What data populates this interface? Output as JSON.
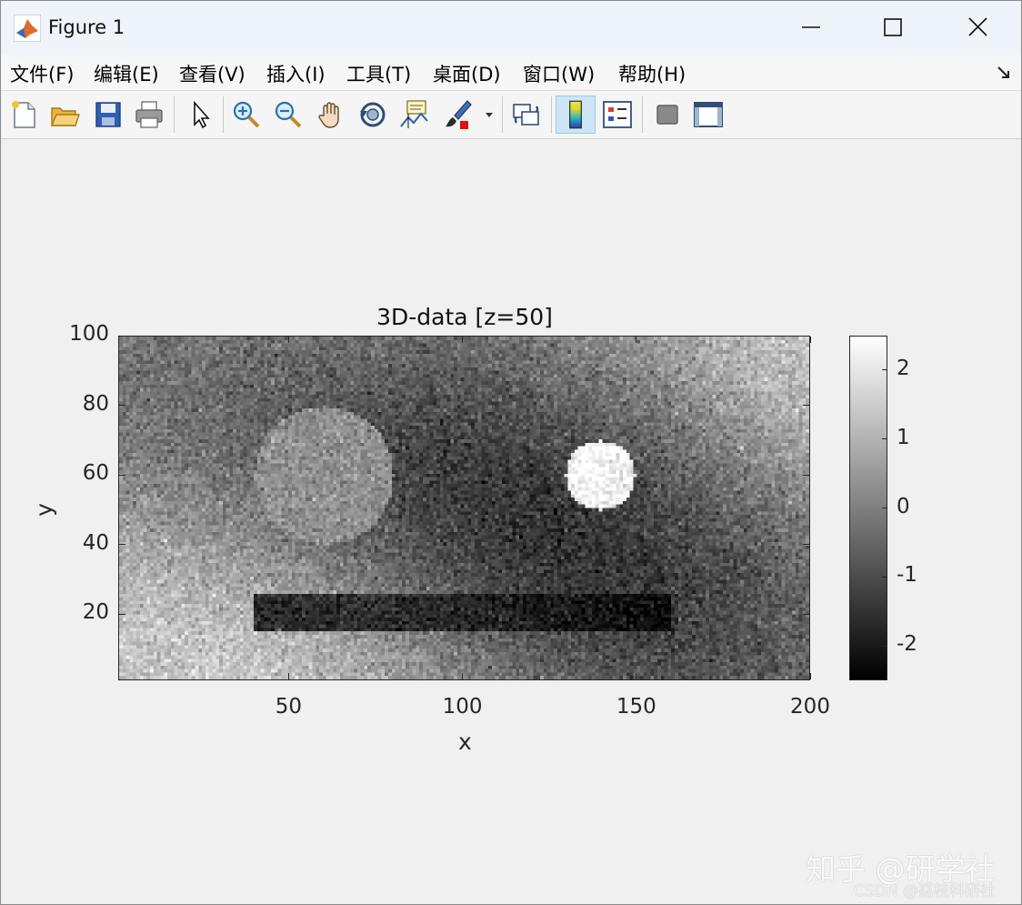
{
  "window": {
    "title": "Figure 1",
    "controls": [
      "minimize",
      "maximize",
      "close"
    ]
  },
  "menu": {
    "items": [
      {
        "label": "文件(F)"
      },
      {
        "label": "编辑(E)"
      },
      {
        "label": "查看(V)"
      },
      {
        "label": "插入(I)"
      },
      {
        "label": "工具(T)"
      },
      {
        "label": "桌面(D)"
      },
      {
        "label": "窗口(W)"
      },
      {
        "label": "帮助(H)"
      }
    ]
  },
  "toolbar": {
    "icons": [
      "new-figure-icon",
      "open-file-icon",
      "save-icon",
      "print-icon",
      "select-arrow-icon",
      "zoom-in-icon",
      "zoom-out-icon",
      "pan-hand-icon",
      "rotate-3d-icon",
      "data-cursor-icon",
      "brush-icon",
      "link-plot-icon",
      "colorbar-icon",
      "legend-icon",
      "hide-plot-tools-icon",
      "show-plot-tools-icon"
    ],
    "active": "colorbar-icon"
  },
  "chart_data": {
    "type": "heatmap",
    "title": "3D-data [z=50]",
    "xlabel": "x",
    "ylabel": "y",
    "xlim": [
      1,
      200
    ],
    "ylim": [
      1,
      100
    ],
    "xticks": [
      50,
      100,
      150,
      200
    ],
    "yticks": [
      20,
      40,
      60,
      80,
      100
    ],
    "colormap": "gray",
    "clim": [
      -2.5,
      2.5
    ],
    "colorbar_ticks": [
      -2,
      -1,
      0,
      1,
      2
    ],
    "colorbar_tick_labels": [
      "-2",
      "-1",
      "0",
      "1",
      "2"
    ],
    "shapes": [
      {
        "kind": "circle",
        "center": [
          60,
          60
        ],
        "radius": 20,
        "value": 0.3
      },
      {
        "kind": "circle",
        "center": [
          140,
          60
        ],
        "radius": 10,
        "value": 2.3
      },
      {
        "kind": "rectangle",
        "x": [
          40,
          160
        ],
        "y": [
          15,
          25
        ],
        "value": -2.0
      }
    ],
    "background": "smooth diagonal gradient with noise, approx -1.5 to 1.5"
  },
  "watermark": {
    "zhihu": "知乎 @研学社",
    "csdn": "CSDN @荔枝科研社"
  }
}
